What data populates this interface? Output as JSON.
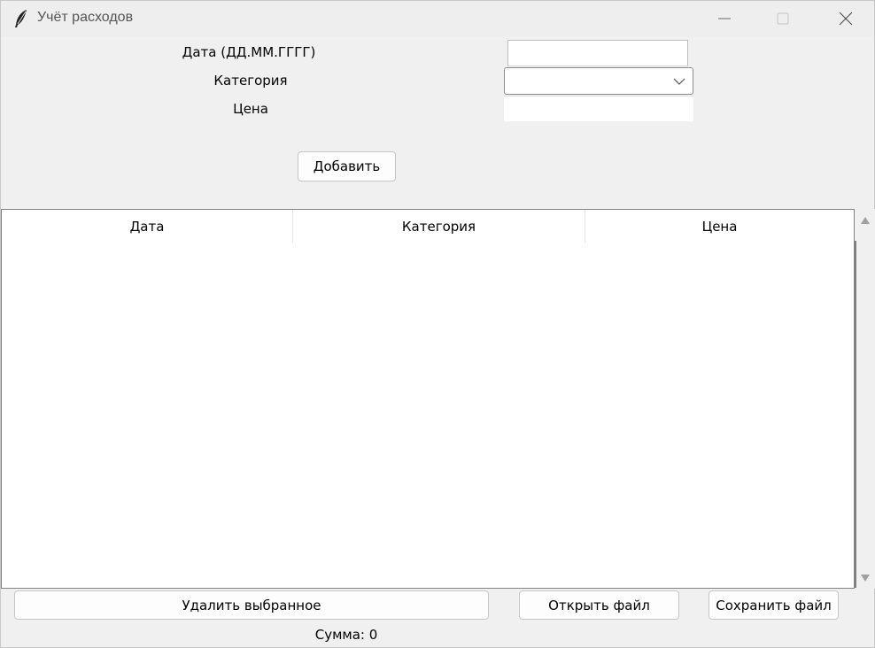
{
  "window": {
    "title": "Учёт расходов",
    "icon": "feather-icon",
    "controls": [
      "minimize-icon",
      "maximize-icon",
      "close-icon"
    ]
  },
  "form": {
    "date_label": "Дата (ДД.ММ.ГГГГ)",
    "date_value": "",
    "category_label": "Категория",
    "category_value": "",
    "price_label": "Цена",
    "price_value": "",
    "add_button": "Добавить"
  },
  "table": {
    "columns": [
      "Дата",
      "Категория",
      "Цена"
    ],
    "rows": []
  },
  "actions": {
    "delete_button": "Удалить выбранное",
    "open_button": "Открыть файл",
    "save_button": "Сохранить файл"
  },
  "status": {
    "sum_text": "Сумма: 0"
  },
  "colors": {
    "window_bg": "#f0f0f0",
    "table_bg": "#ffffff",
    "border": "#828282"
  }
}
